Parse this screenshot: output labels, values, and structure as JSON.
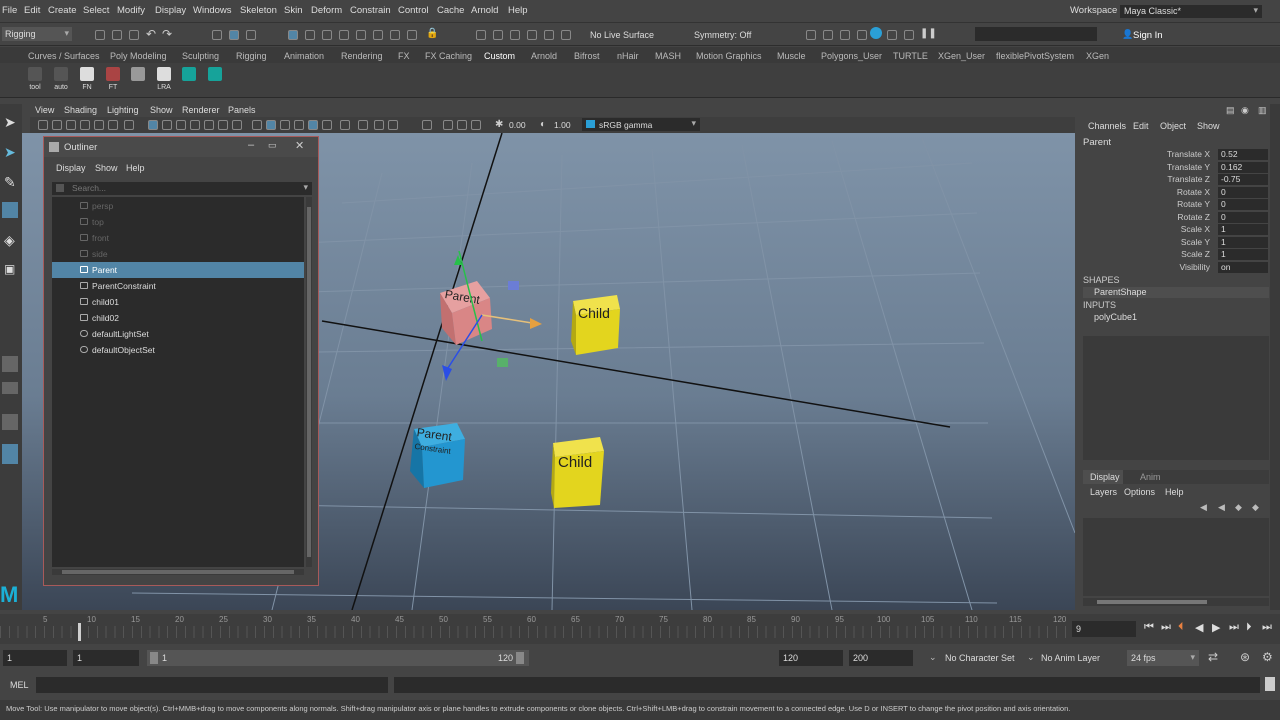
{
  "menubar": {
    "items": [
      "File",
      "Edit",
      "Create",
      "Select",
      "Modify",
      "Display",
      "Windows",
      "Skeleton",
      "Skin",
      "Deform",
      "Constrain",
      "Control",
      "Cache",
      "Arnold",
      "Help"
    ],
    "workspace_label": "Workspace :",
    "workspace_value": "Maya Classic*"
  },
  "statusline": {
    "mode": "Rigging",
    "live_surface": "No Live Surface",
    "symmetry": "Symmetry: Off",
    "sign_in": "Sign In"
  },
  "shelf_tabs": [
    "Curves / Surfaces",
    "Poly Modeling",
    "Sculpting",
    "Rigging",
    "Animation",
    "Rendering",
    "FX",
    "FX Caching",
    "Custom",
    "Arnold",
    "Bifrost",
    "nHair",
    "MASH",
    "Motion Graphics",
    "Muscle",
    "Polygons_User",
    "TURTLE",
    "XGen_User",
    "flexiblePivotSystem",
    "XGen"
  ],
  "shelf_active": "Custom",
  "shelf_buttons": [
    "tool",
    "auto",
    "FN",
    "FT",
    "LRA"
  ],
  "viewport": {
    "menus": [
      "View",
      "Shading",
      "Lighting",
      "Show",
      "Renderer",
      "Panels"
    ],
    "exposure": "0.00",
    "gamma": "1.00",
    "colorspace": "sRGB gamma",
    "labels": {
      "parent_top": "Parent",
      "child_top": "Child",
      "parent_bottom": "Parent",
      "constraint_bottom": "Constraint",
      "child_bottom": "Child"
    }
  },
  "outliner": {
    "title": "Outliner",
    "menus": [
      "Display",
      "Show",
      "Help"
    ],
    "search_placeholder": "Search...",
    "items": [
      {
        "name": "persp",
        "dim": true
      },
      {
        "name": "top",
        "dim": true
      },
      {
        "name": "front",
        "dim": true
      },
      {
        "name": "side",
        "dim": true
      },
      {
        "name": "Parent",
        "selected": true
      },
      {
        "name": "ParentConstraint"
      },
      {
        "name": "child01"
      },
      {
        "name": "child02"
      },
      {
        "name": "defaultLightSet"
      },
      {
        "name": "defaultObjectSet"
      }
    ]
  },
  "channelbox": {
    "menus": [
      "Channels",
      "Edit",
      "Object",
      "Show"
    ],
    "object": "Parent",
    "attributes": [
      {
        "name": "Translate X",
        "value": "0.52"
      },
      {
        "name": "Translate Y",
        "value": "0.162"
      },
      {
        "name": "Translate Z",
        "value": "-0.75"
      },
      {
        "name": "Rotate X",
        "value": "0"
      },
      {
        "name": "Rotate Y",
        "value": "0"
      },
      {
        "name": "Rotate Z",
        "value": "0"
      },
      {
        "name": "Scale X",
        "value": "1"
      },
      {
        "name": "Scale Y",
        "value": "1"
      },
      {
        "name": "Scale Z",
        "value": "1"
      },
      {
        "name": "Visibility",
        "value": "on"
      }
    ],
    "shapes_header": "SHAPES",
    "shape": "ParentShape",
    "inputs_header": "INPUTS",
    "input": "polyCube1"
  },
  "layer_editor": {
    "tabs": [
      "Display",
      "Anim"
    ],
    "menus": [
      "Layers",
      "Options",
      "Help"
    ]
  },
  "timeslider": {
    "ticks": [
      "5",
      "10",
      "15",
      "20",
      "25",
      "30",
      "35",
      "40",
      "45",
      "50",
      "55",
      "60",
      "65",
      "70",
      "75",
      "80",
      "85",
      "90",
      "95",
      "100",
      "105",
      "110",
      "115",
      "120"
    ],
    "current_frame": "9"
  },
  "range": {
    "start": "1",
    "playback_start": "1",
    "slider_start": "1",
    "slider_end": "120",
    "playback_end": "120",
    "end": "200",
    "character_set": "No Character Set",
    "anim_layer": "No Anim Layer",
    "fps": "24 fps"
  },
  "cmdline": {
    "label": "MEL"
  },
  "helpline": {
    "text": "Move Tool: Use manipulator to move object(s). Ctrl+MMB+drag to move components along normals. Shift+drag manipulator axis or plane handles to extrude components or clone objects. Ctrl+Shift+LMB+drag to constrain movement to a connected edge. Use D or INSERT to change the pivot position and axis orientation."
  },
  "colors": {
    "selection": "#5285a6",
    "parent_cube": "#d98686",
    "child_cube": "#e3d51e",
    "constraint_cube": "#2396d0"
  }
}
